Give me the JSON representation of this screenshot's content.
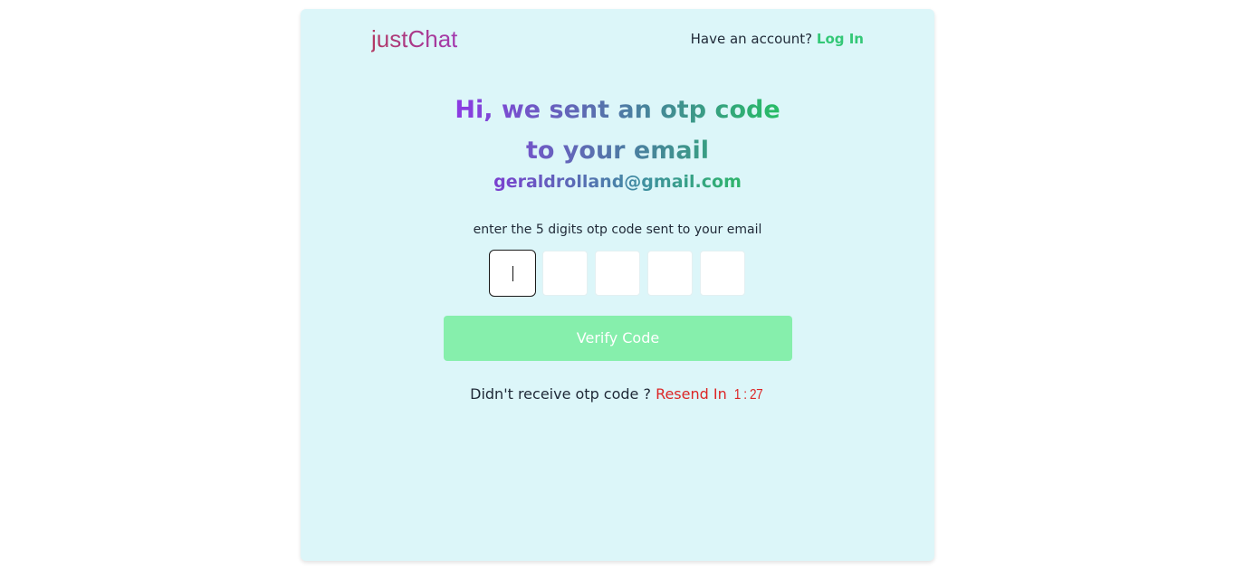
{
  "header": {
    "brand": "justChat",
    "account_prompt": "Have an account?",
    "login_label": "Log In"
  },
  "main": {
    "headline": "Hi, we sent an otp code to your email",
    "email": "geraldrolland@gmail.com",
    "instruction": "enter the 5 digits otp code sent to your email",
    "otp_digits": [
      "",
      "",
      "",
      "",
      ""
    ],
    "verify_label": "Verify Code",
    "resend_prompt": "Didn't receive otp code ?",
    "resend_label": "Resend In",
    "timer": "1 : 27"
  },
  "colors": {
    "card_background": "#dcf6f9",
    "accent_green": "#34c877",
    "verify_button": "#86efac",
    "resend_red": "#dc2626"
  }
}
